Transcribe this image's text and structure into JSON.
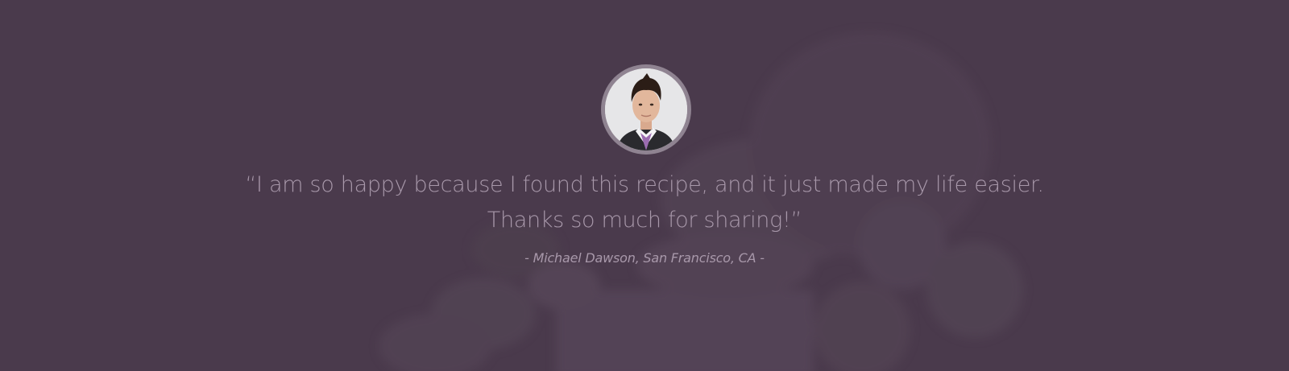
{
  "testimonial": {
    "quote_line1": "“I am so happy because I found this recipe, and it just made my life easier.",
    "quote_line2": "Thanks  so much for sharing!”",
    "author": "- Michael Dawson, San Francisco, CA -"
  },
  "colors": {
    "background": "#4a3a4c",
    "text": "#a898aa",
    "avatar_ring": "#8f8391"
  }
}
